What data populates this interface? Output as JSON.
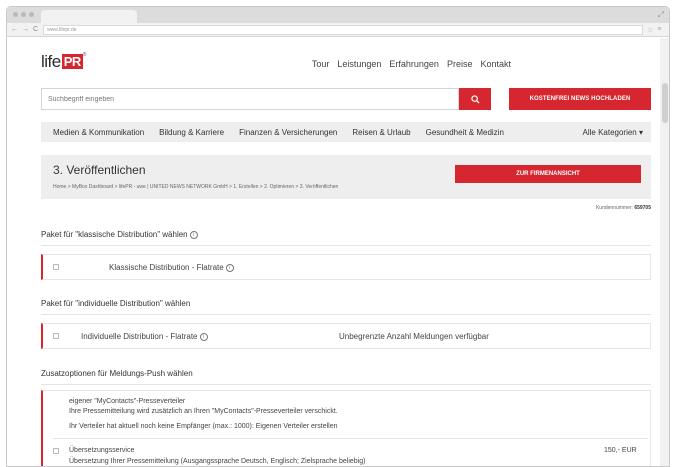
{
  "browser": {
    "url": "www.lifepr.de"
  },
  "logo": {
    "text": "life",
    "badge": "PR",
    "reg": "®"
  },
  "topnav": [
    "Tour",
    "Leistungen",
    "Erfahrungen",
    "Preise",
    "Kontakt"
  ],
  "search": {
    "placeholder": "Suchbegriff eingeben",
    "icon": "search-icon",
    "upload_label": "KOSTENFREI NEWS HOCHLADEN"
  },
  "categories": [
    "Medien & Kommunikation",
    "Bildung & Karriere",
    "Finanzen & Versicherungen",
    "Reisen & Urlaub",
    "Gesundheit & Medizin"
  ],
  "categories_all": "Alle Kategorien ▾",
  "page": {
    "title": "3. Veröffentlichen",
    "breadcrumb": "Home > MyBox Dashboard > lifePR - uwe | UNITED NEWS NETWORK GmbH > 1. Erstellen > 2. Optimieren > 3. Veröffentlichen",
    "firm_button": "ZUR FIRMENANSICHT",
    "customer_label": "Kundennummer:",
    "customer_number": "659705"
  },
  "sections": {
    "classic_title": "Paket für \"klassische Distribution\" wählen",
    "classic_option": "Klassische Distribution - Flatrate",
    "individual_title": "Paket für \"individuelle Distribution\" wählen",
    "individual_option": "Individuelle Distribution - Flatrate",
    "individual_note": "Unbegrenzte Anzahl Meldungen verfügbar",
    "push_title": "Zusatzoptionen für Meldungs-Push wählen",
    "mycontacts_title": "eigener \"MyContacts\"-Presseverteiler",
    "mycontacts_desc": "Ihre Pressemitteilung wird zusätzlich an Ihren \"MyContacts\"-Presseverteiler verschickt.",
    "mycontacts_note": "Ihr Verteiler hat aktuell noch keine Empfänger (max.: 1000): Eigenen Verteiler erstellen",
    "translation_title": "Übersetzungsservice",
    "translation_price": "150,- EUR",
    "translation_desc": "Übersetzung Ihrer Pressemitteilung (Ausgangssprache Deutsch, Englisch; Zielsprache beliebig)"
  },
  "colors": {
    "accent": "#d6262f",
    "bar_bg": "#eeeeee"
  }
}
